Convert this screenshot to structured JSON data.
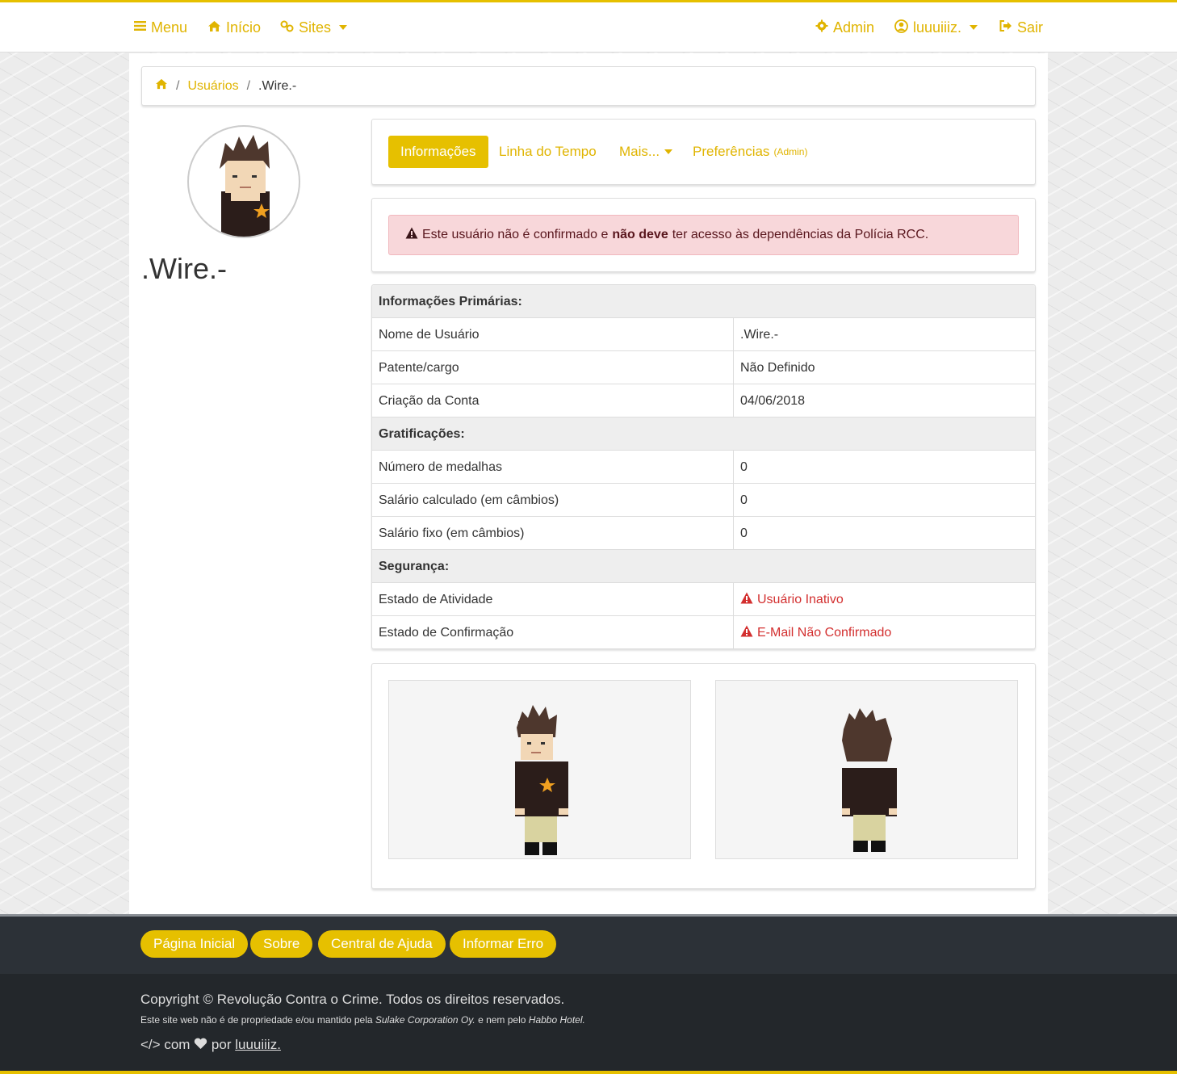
{
  "nav": {
    "menu": "Menu",
    "home": "Início",
    "sites": "Sites",
    "admin": "Admin",
    "user": "luuuiiiz.",
    "logout": "Sair"
  },
  "breadcrumb": {
    "users": "Usuários",
    "current": ".Wire.-"
  },
  "profile": {
    "name": ".Wire.-"
  },
  "tabs": {
    "info": "Informações",
    "timeline": "Linha do Tempo",
    "more": "Mais...",
    "prefs": "Preferências",
    "prefs_note": "(Admin)"
  },
  "alert": {
    "before": "Este usuário não é confirmado e",
    "bold": "não deve",
    "after": "ter acesso às dependências da Polícia RCC."
  },
  "table": {
    "primary_header": "Informações Primárias:",
    "username_label": "Nome de Usuário",
    "username_value": ".Wire.-",
    "rank_label": "Patente/cargo",
    "rank_value": "Não Definido",
    "created_label": "Criação da Conta",
    "created_value": "04/06/2018",
    "grat_header": "Gratificações:",
    "medals_label": "Número de medalhas",
    "medals_value": "0",
    "salary_calc_label": "Salário calculado (em câmbios)",
    "salary_calc_value": "0",
    "salary_fixed_label": "Salário fixo (em câmbios)",
    "salary_fixed_value": "0",
    "security_header": "Segurança:",
    "activity_label": "Estado de Atividade",
    "activity_value": "Usuário Inativo",
    "confirm_label": "Estado de Confirmação",
    "confirm_value": "E-Mail Não Confirmado"
  },
  "footer": {
    "btn_home": "Página Inicial",
    "btn_about": "Sobre",
    "btn_help": "Central de Ajuda",
    "btn_report": "Informar Erro",
    "copyright": "Copyright © Revolução Contra o Crime. Todos os direitos reservados.",
    "disclaimer_1": "Este site web não é de propriedade e/ou mantido pela",
    "disclaimer_company": "Sulake Corporation Oy.",
    "disclaimer_2": "e nem pelo",
    "disclaimer_hotel": "Habbo Hotel.",
    "code_symbol": "</>",
    "made_with": "com",
    "made_by": "por",
    "author": "luuuiiiz."
  },
  "colors": {
    "accent": "#e6c000",
    "danger": "#d32f2f",
    "footer_bg": "#2c3137"
  },
  "icons": [
    "menu-icon",
    "home-icon",
    "link-icon",
    "gear-icon",
    "user-circle-icon",
    "logout-icon",
    "warning-icon",
    "heart-icon"
  ]
}
